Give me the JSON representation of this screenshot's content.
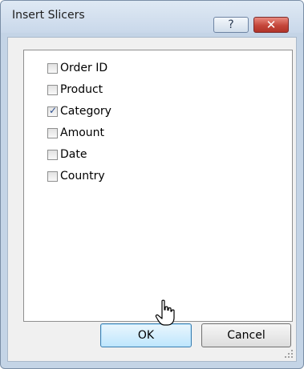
{
  "dialog": {
    "title": "Insert Slicers",
    "help_button": "?",
    "close_button": "✕"
  },
  "fields": [
    {
      "label": "Order ID",
      "checked": false
    },
    {
      "label": "Product",
      "checked": false
    },
    {
      "label": "Category",
      "checked": true
    },
    {
      "label": "Amount",
      "checked": false
    },
    {
      "label": "Date",
      "checked": false
    },
    {
      "label": "Country",
      "checked": false
    }
  ],
  "buttons": {
    "ok_label": "OK",
    "cancel_label": "Cancel"
  },
  "colors": {
    "titlebar": "#c9d8ea",
    "close_button": "#c4473b",
    "ok_button_hover": "#bee6fd",
    "checkmark": "#2b4f91"
  }
}
